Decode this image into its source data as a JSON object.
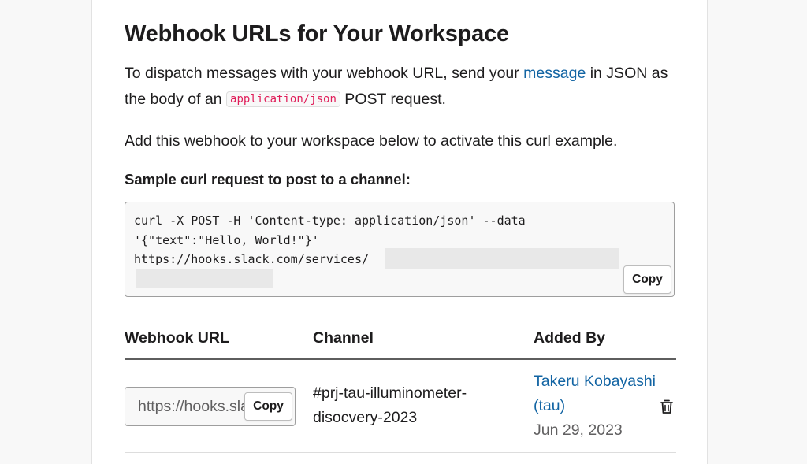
{
  "heading": "Webhook URLs for Your Workspace",
  "intro": {
    "part1": "To dispatch messages with your webhook URL, send your ",
    "link_text": "message",
    "part2": " in JSON as the body of an ",
    "code": "application/json",
    "part3": " POST request."
  },
  "add_note": "Add this webhook to your workspace below to activate this curl example.",
  "sample": {
    "label": "Sample curl request to post to a channel:",
    "code": "curl -X POST -H 'Content-type: application/json' --data\n'{\"text\":\"Hello, World!\"}'\nhttps://hooks.slack.com/services/",
    "copy_label": "Copy"
  },
  "table": {
    "headers": [
      "Webhook URL",
      "Channel",
      "Added By"
    ],
    "rows": [
      {
        "url_value": "https://hooks.slack.com/services/",
        "copy_label": "Copy",
        "channel": "#prj-tau-illuminometer-disocvery-2023",
        "added_by_name": "Takeru Kobayashi (tau)",
        "added_date": "Jun 29, 2023",
        "delete_icon": "trash-icon"
      }
    ]
  },
  "colors": {
    "link": "#1264a3",
    "inline_code": "#e01e5a",
    "text": "#1d1c1d",
    "muted": "#616061"
  }
}
